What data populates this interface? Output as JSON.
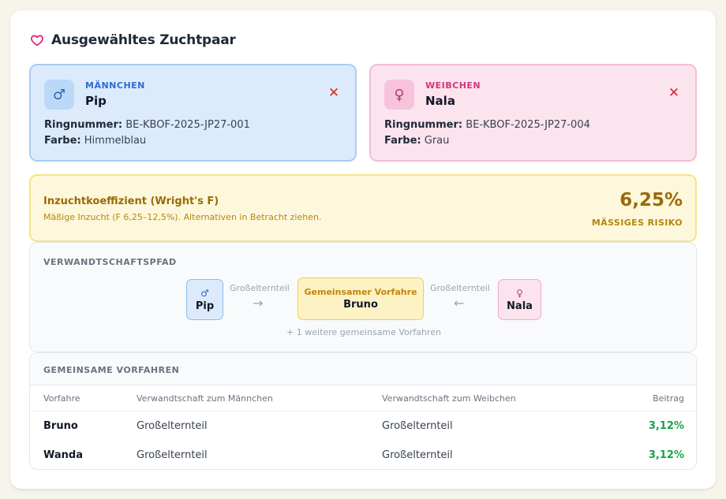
{
  "header": {
    "title": "Ausgewähltes Zuchtpaar",
    "icon": "heart-icon",
    "icon_color": "#e11d74"
  },
  "male": {
    "role": "MÄNNCHEN",
    "symbol": "♂",
    "name": "Pip",
    "ring_label": "Ringnummer:",
    "ring_value": "BE-KBOF-2025-JP27-001",
    "color_label": "Farbe:",
    "color_value": "Himmelblau",
    "remove_symbol": "✕"
  },
  "female": {
    "role": "WEIBCHEN",
    "symbol": "♀",
    "name": "Nala",
    "ring_label": "Ringnummer:",
    "ring_value": "BE-KBOF-2025-JP27-004",
    "color_label": "Farbe:",
    "color_value": "Grau",
    "remove_symbol": "✕"
  },
  "coefficient": {
    "title": "Inzuchtkoeffizient (Wright's F)",
    "subtitle": "Mäßige Inzucht (F 6,25–12,5%). Alternativen in Betracht ziehen.",
    "value": "6,25%",
    "risk": "MÄSSIGES RISIKO",
    "accent": "#9a6a06"
  },
  "path": {
    "label": "VERWANDTSCHAFTSPFAD",
    "male_symbol": "♂",
    "male_name": "Pip",
    "left_relation": "Großelternteil",
    "left_arrow": "→",
    "common_title": "Gemeinsamer Vorfahre",
    "common_name": "Bruno",
    "right_relation": "Großelternteil",
    "right_arrow": "←",
    "female_symbol": "♀",
    "female_name": "Nala",
    "more_text": "+ 1 weitere gemeinsame Vorfahren"
  },
  "ancestors": {
    "label": "GEMEINSAME VORFAHREN",
    "columns": [
      "Vorfahre",
      "Verwandtschaft zum Männchen",
      "Verwandtschaft zum Weibchen",
      "Beitrag"
    ],
    "rows": [
      [
        "Bruno",
        "Großelternteil",
        "Großelternteil",
        "3,12%"
      ],
      [
        "Wanda",
        "Großelternteil",
        "Großelternteil",
        "3,12%"
      ]
    ]
  }
}
